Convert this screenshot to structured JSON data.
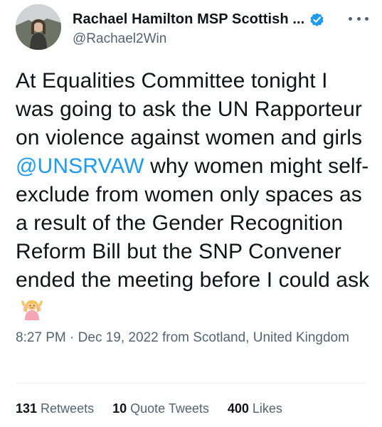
{
  "tweet": {
    "author": {
      "display_name": "Rachael Hamilton MSP Scottish ...",
      "handle": "@Rachael2Win",
      "verified": true,
      "verified_color": "#1d9bf0",
      "avatar_icon": "profile-photo"
    },
    "more_icon": "more-options-icon",
    "text": {
      "before_mention": "At Equalities Committee tonight I was going to ask the UN Rapporteur on violence against women and girls ",
      "mention": "@UNSRVAW",
      "after_mention": " why women might self-exclude from women only spaces as a result of the Gender Recognition Reform Bill but the SNP Convener ended the meeting before I could ask",
      "emoji": "person-shrugging-emoji"
    },
    "meta": {
      "time": "8:27 PM",
      "separator": " · ",
      "date": "Dec 19, 2022",
      "location": " from Scotland, United Kingdom"
    },
    "stats": {
      "retweets_count": "131",
      "retweets_label": "Retweets",
      "quotes_count": "10",
      "quotes_label": "Quote Tweets",
      "likes_count": "400",
      "likes_label": "Likes"
    },
    "colors": {
      "text": "#0f1419",
      "secondary": "#536471",
      "link": "#1d9bf0",
      "divider": "#eff3f4"
    }
  }
}
